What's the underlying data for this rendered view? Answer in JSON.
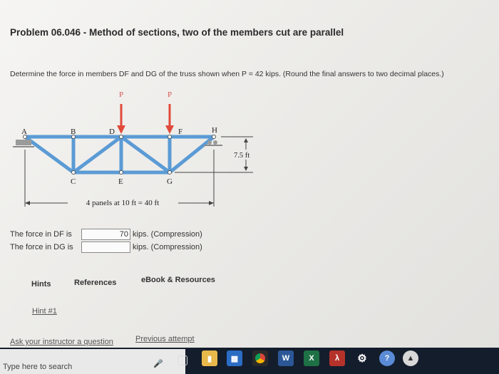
{
  "problem": {
    "title": "Problem 06.046 - Method of sections, two of the members cut are parallel",
    "question": "Determine the force in members DF and DG of the truss shown when P = 42 kips. (Round the final answers to two decimal places.)"
  },
  "figure": {
    "load_labels": [
      "P",
      "P"
    ],
    "top_nodes": [
      "A",
      "B",
      "D",
      "F",
      "H"
    ],
    "bottom_nodes": [
      "C",
      "E",
      "G"
    ],
    "height_label": "7.5 ft",
    "span_label": "4 panels at 10 ft = 40 ft"
  },
  "answers": [
    {
      "label": "The force in DF is",
      "value": "70",
      "unit": "kips. (Compression)"
    },
    {
      "label": "The force in DG is",
      "value": "",
      "unit": "kips. (Compression)"
    }
  ],
  "tabs": {
    "hints": "Hints",
    "references": "References",
    "ebook": "eBook & Resources"
  },
  "links": {
    "hint1": "Hint #1",
    "ask": "Ask your instructor a question",
    "previous": "Previous attempt"
  },
  "taskbar": {
    "search_placeholder": "Type here to search",
    "icons": [
      "mic-icon",
      "task-view-icon",
      "file-explorer-icon",
      "store-icon",
      "chrome-icon",
      "word-icon",
      "excel-icon",
      "acrobat-icon",
      "settings-icon",
      "help-icon",
      "feedback-icon"
    ]
  },
  "colors": {
    "truss": "#5b9bd5",
    "load_arrow": "#e04a3a"
  }
}
